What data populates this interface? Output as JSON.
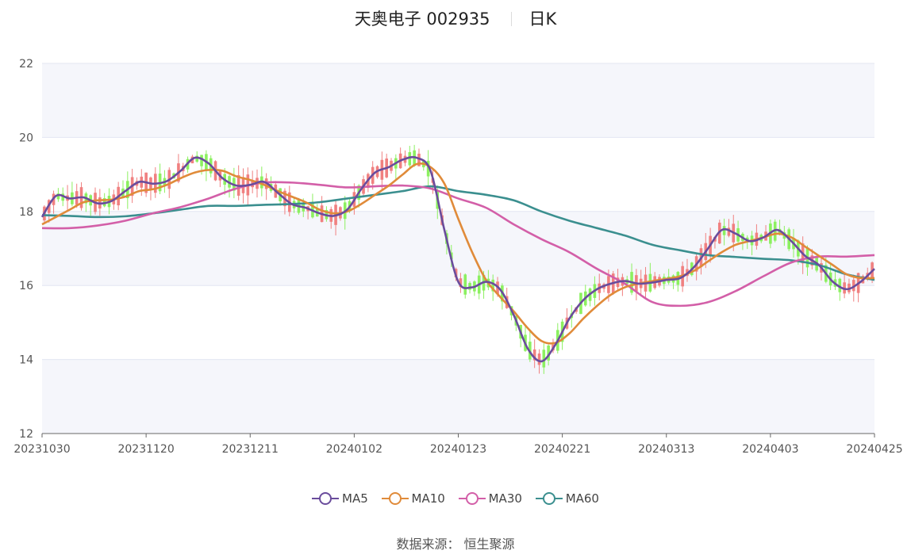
{
  "header": {
    "name": "天奥电子 002935",
    "period": "日K"
  },
  "source": "数据来源： 恒生聚源",
  "colors": {
    "up": "#f08080",
    "down": "#8cf060",
    "MA5": "#6a4c9c",
    "MA10": "#e08b3a",
    "MA30": "#d35fa8",
    "MA60": "#3b8f8f"
  },
  "chart_data": {
    "type": "candlestick",
    "ylim": [
      12,
      22
    ],
    "yticks": [
      12,
      14,
      16,
      18,
      20,
      22
    ],
    "x_tick_labels": [
      "20231030",
      "20231120",
      "20231211",
      "20240102",
      "20240123",
      "20240221",
      "20240313",
      "20240403",
      "20240425"
    ],
    "grid": true,
    "legend_position": "bottom",
    "ma_series": [
      {
        "name": "MA5",
        "points": [
          [
            0,
            17.85
          ],
          [
            3,
            18.42
          ],
          [
            6,
            18.35
          ],
          [
            9,
            18.38
          ],
          [
            12,
            18.22
          ],
          [
            15,
            18.28
          ],
          [
            18,
            18.55
          ],
          [
            21,
            18.8
          ],
          [
            24,
            18.75
          ],
          [
            27,
            18.82
          ],
          [
            30,
            19.1
          ],
          [
            33,
            19.45
          ],
          [
            36,
            19.3
          ],
          [
            39,
            18.9
          ],
          [
            42,
            18.7
          ],
          [
            45,
            18.72
          ],
          [
            48,
            18.8
          ],
          [
            51,
            18.5
          ],
          [
            54,
            18.2
          ],
          [
            57,
            18.1
          ],
          [
            60,
            17.95
          ],
          [
            63,
            17.88
          ],
          [
            66,
            18.05
          ],
          [
            69,
            18.6
          ],
          [
            72,
            19.05
          ],
          [
            75,
            19.2
          ],
          [
            78,
            19.4
          ],
          [
            81,
            19.45
          ],
          [
            84,
            19.1
          ],
          [
            87,
            17.5
          ],
          [
            90,
            16.1
          ],
          [
            93,
            15.95
          ],
          [
            96,
            16.1
          ],
          [
            99,
            15.9
          ],
          [
            102,
            15.2
          ],
          [
            105,
            14.3
          ],
          [
            108,
            13.95
          ],
          [
            111,
            14.4
          ],
          [
            114,
            15.1
          ],
          [
            117,
            15.6
          ],
          [
            120,
            15.9
          ],
          [
            123,
            16.05
          ],
          [
            126,
            16.12
          ],
          [
            129,
            16.05
          ],
          [
            132,
            16.08
          ],
          [
            135,
            16.15
          ],
          [
            138,
            16.2
          ],
          [
            141,
            16.5
          ],
          [
            144,
            17.0
          ],
          [
            147,
            17.5
          ],
          [
            150,
            17.4
          ],
          [
            153,
            17.2
          ],
          [
            156,
            17.3
          ],
          [
            159,
            17.5
          ],
          [
            162,
            17.2
          ],
          [
            165,
            16.8
          ],
          [
            168,
            16.55
          ],
          [
            171,
            16.1
          ],
          [
            174,
            15.9
          ],
          [
            177,
            16.1
          ],
          [
            180,
            16.45
          ]
        ]
      },
      {
        "name": "MA10",
        "points": [
          [
            0,
            17.65
          ],
          [
            3,
            17.85
          ],
          [
            6,
            18.05
          ],
          [
            9,
            18.25
          ],
          [
            12,
            18.3
          ],
          [
            15,
            18.32
          ],
          [
            18,
            18.4
          ],
          [
            21,
            18.55
          ],
          [
            24,
            18.6
          ],
          [
            27,
            18.72
          ],
          [
            30,
            18.9
          ],
          [
            33,
            19.05
          ],
          [
            36,
            19.12
          ],
          [
            39,
            19.1
          ],
          [
            42,
            18.95
          ],
          [
            45,
            18.85
          ],
          [
            48,
            18.72
          ],
          [
            51,
            18.55
          ],
          [
            54,
            18.4
          ],
          [
            57,
            18.25
          ],
          [
            60,
            18.05
          ],
          [
            63,
            17.95
          ],
          [
            66,
            18.0
          ],
          [
            69,
            18.2
          ],
          [
            72,
            18.45
          ],
          [
            75,
            18.7
          ],
          [
            78,
            19.0
          ],
          [
            81,
            19.28
          ],
          [
            84,
            19.2
          ],
          [
            87,
            18.75
          ],
          [
            90,
            17.8
          ],
          [
            93,
            16.9
          ],
          [
            96,
            16.15
          ],
          [
            99,
            15.7
          ],
          [
            102,
            15.3
          ],
          [
            105,
            14.85
          ],
          [
            108,
            14.5
          ],
          [
            111,
            14.45
          ],
          [
            114,
            14.7
          ],
          [
            117,
            15.1
          ],
          [
            120,
            15.45
          ],
          [
            123,
            15.75
          ],
          [
            126,
            15.95
          ],
          [
            129,
            16.05
          ],
          [
            132,
            16.12
          ],
          [
            135,
            16.18
          ],
          [
            138,
            16.25
          ],
          [
            141,
            16.4
          ],
          [
            144,
            16.65
          ],
          [
            147,
            16.9
          ],
          [
            150,
            17.1
          ],
          [
            153,
            17.2
          ],
          [
            156,
            17.3
          ],
          [
            159,
            17.4
          ],
          [
            162,
            17.3
          ],
          [
            165,
            17.05
          ],
          [
            168,
            16.8
          ],
          [
            171,
            16.55
          ],
          [
            174,
            16.3
          ],
          [
            177,
            16.2
          ],
          [
            180,
            16.2
          ]
        ]
      },
      {
        "name": "MA30",
        "points": [
          [
            0,
            17.55
          ],
          [
            6,
            17.55
          ],
          [
            12,
            17.62
          ],
          [
            18,
            17.75
          ],
          [
            24,
            17.95
          ],
          [
            30,
            18.12
          ],
          [
            36,
            18.35
          ],
          [
            42,
            18.62
          ],
          [
            48,
            18.78
          ],
          [
            54,
            18.78
          ],
          [
            60,
            18.72
          ],
          [
            66,
            18.65
          ],
          [
            72,
            18.68
          ],
          [
            78,
            18.7
          ],
          [
            84,
            18.62
          ],
          [
            90,
            18.35
          ],
          [
            96,
            18.1
          ],
          [
            102,
            17.65
          ],
          [
            108,
            17.25
          ],
          [
            114,
            16.9
          ],
          [
            120,
            16.45
          ],
          [
            126,
            16.05
          ],
          [
            132,
            15.55
          ],
          [
            138,
            15.45
          ],
          [
            144,
            15.55
          ],
          [
            150,
            15.85
          ],
          [
            156,
            16.25
          ],
          [
            162,
            16.62
          ],
          [
            168,
            16.78
          ],
          [
            174,
            16.78
          ],
          [
            180,
            16.82
          ]
        ]
      },
      {
        "name": "MA60",
        "points": [
          [
            0,
            17.9
          ],
          [
            6,
            17.88
          ],
          [
            12,
            17.85
          ],
          [
            18,
            17.87
          ],
          [
            24,
            17.95
          ],
          [
            30,
            18.05
          ],
          [
            36,
            18.15
          ],
          [
            42,
            18.15
          ],
          [
            48,
            18.18
          ],
          [
            54,
            18.2
          ],
          [
            60,
            18.25
          ],
          [
            66,
            18.35
          ],
          [
            72,
            18.45
          ],
          [
            78,
            18.55
          ],
          [
            84,
            18.68
          ],
          [
            90,
            18.55
          ],
          [
            96,
            18.45
          ],
          [
            102,
            18.3
          ],
          [
            108,
            18.0
          ],
          [
            114,
            17.75
          ],
          [
            120,
            17.55
          ],
          [
            126,
            17.35
          ],
          [
            132,
            17.1
          ],
          [
            138,
            16.95
          ],
          [
            144,
            16.82
          ],
          [
            150,
            16.77
          ],
          [
            156,
            16.72
          ],
          [
            162,
            16.68
          ],
          [
            168,
            16.55
          ],
          [
            174,
            16.3
          ],
          [
            180,
            16.15
          ]
        ]
      }
    ]
  }
}
